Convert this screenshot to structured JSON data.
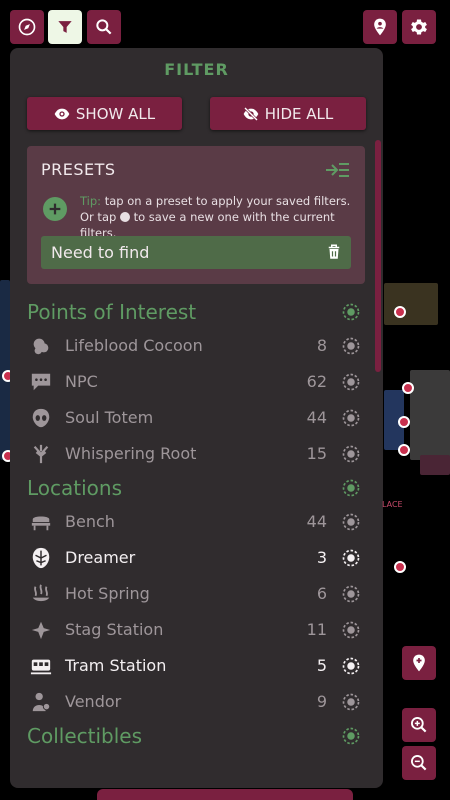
{
  "topbar": {
    "left_icons": [
      "compass-icon",
      "filter-icon",
      "search-icon"
    ],
    "right_icons": [
      "add-location-icon",
      "gear-icon"
    ]
  },
  "filter": {
    "title": "FILTER",
    "show_all": "SHOW ALL",
    "hide_all": "HIDE ALL"
  },
  "presets": {
    "title": "PRESETS",
    "tip_label": "Tip:",
    "tip_part1": " tap on a preset to apply your saved filters. Or tap ",
    "tip_part2": " to save a new one with the current filters.",
    "items": [
      {
        "label": "Need to find"
      }
    ]
  },
  "sections": [
    {
      "label": "Points of Interest",
      "rows": [
        {
          "label": "Lifeblood Cocoon",
          "count": "8",
          "icon": "cocoon-icon",
          "enabled": false
        },
        {
          "label": "NPC",
          "count": "62",
          "icon": "speech-bubble-icon",
          "enabled": false
        },
        {
          "label": "Soul Totem",
          "count": "44",
          "icon": "totem-icon",
          "enabled": false
        },
        {
          "label": "Whispering Root",
          "count": "15",
          "icon": "root-icon",
          "enabled": false
        }
      ]
    },
    {
      "label": "Locations",
      "rows": [
        {
          "label": "Bench",
          "count": "44",
          "icon": "bench-icon",
          "enabled": false
        },
        {
          "label": "Dreamer",
          "count": "3",
          "icon": "dreamer-mask-icon",
          "enabled": true
        },
        {
          "label": "Hot Spring",
          "count": "6",
          "icon": "hot-spring-icon",
          "enabled": false
        },
        {
          "label": "Stag Station",
          "count": "11",
          "icon": "stag-icon",
          "enabled": false
        },
        {
          "label": "Tram Station",
          "count": "5",
          "icon": "tram-icon",
          "enabled": true
        },
        {
          "label": "Vendor",
          "count": "9",
          "icon": "vendor-icon",
          "enabled": false
        }
      ]
    },
    {
      "label": "Collectibles",
      "rows": []
    }
  ],
  "colors": {
    "accent": "#7a2040",
    "green": "#5f9b63",
    "panel": "#302c2e"
  }
}
